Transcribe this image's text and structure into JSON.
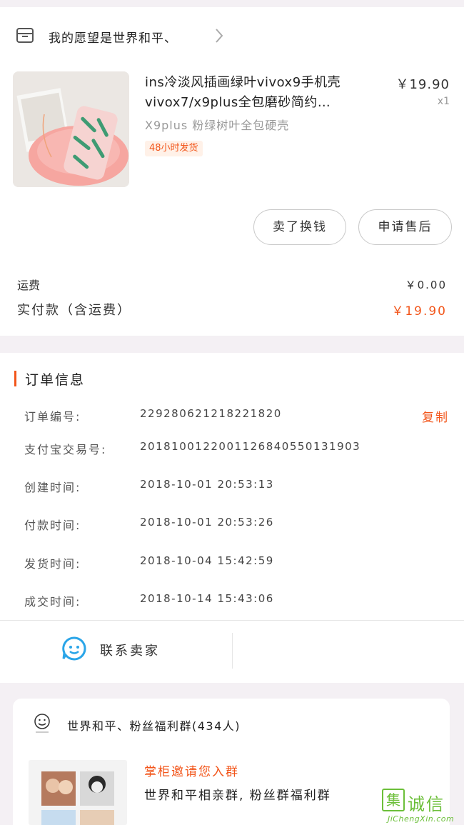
{
  "shop": {
    "name": "我的愿望是世界和平、",
    "icon": "store-icon"
  },
  "item": {
    "title_line1": "ins冷淡风插画绿叶vivox9手机壳",
    "title_line2": "vivox7/x9plus全包磨砂简约…",
    "price": "￥19.90",
    "quantity": "x1",
    "spec": "X9plus 粉绿树叶全包硬壳",
    "ship_badge": "48小时发货"
  },
  "actions": {
    "sell_label": "卖了换钱",
    "after_sale_label": "申请售后"
  },
  "fees": {
    "shipping_label": "运费",
    "shipping_value": "￥0.00",
    "total_label": "实付款（含运费）",
    "total_value": "￥19.90"
  },
  "order": {
    "section_title": "订单信息",
    "copy_label": "复制",
    "rows": [
      {
        "label": "订单编号:",
        "value": "229280621218221820"
      },
      {
        "label": "支付宝交易号:",
        "value": "2018100122001126840550131903"
      },
      {
        "label": "创建时间:",
        "value": "2018-10-01 20:53:13"
      },
      {
        "label": "付款时间:",
        "value": "2018-10-01 20:53:26"
      },
      {
        "label": "发货时间:",
        "value": "2018-10-04 15:42:59"
      },
      {
        "label": "成交时间:",
        "value": "2018-10-14 15:43:06"
      }
    ],
    "contact_label": "联系卖家"
  },
  "group": {
    "name": "世界和平、粉丝福利群(434人)",
    "invite": "掌柜邀请您入群",
    "description": "世界和平相亲群, 粉丝群福利群"
  },
  "watermark": {
    "text": "诚信",
    "sub": "JiChengXin.com"
  },
  "colors": {
    "accent": "#f2551a",
    "contact_icon": "#2aa5e8",
    "background": "#f4f0f4"
  }
}
